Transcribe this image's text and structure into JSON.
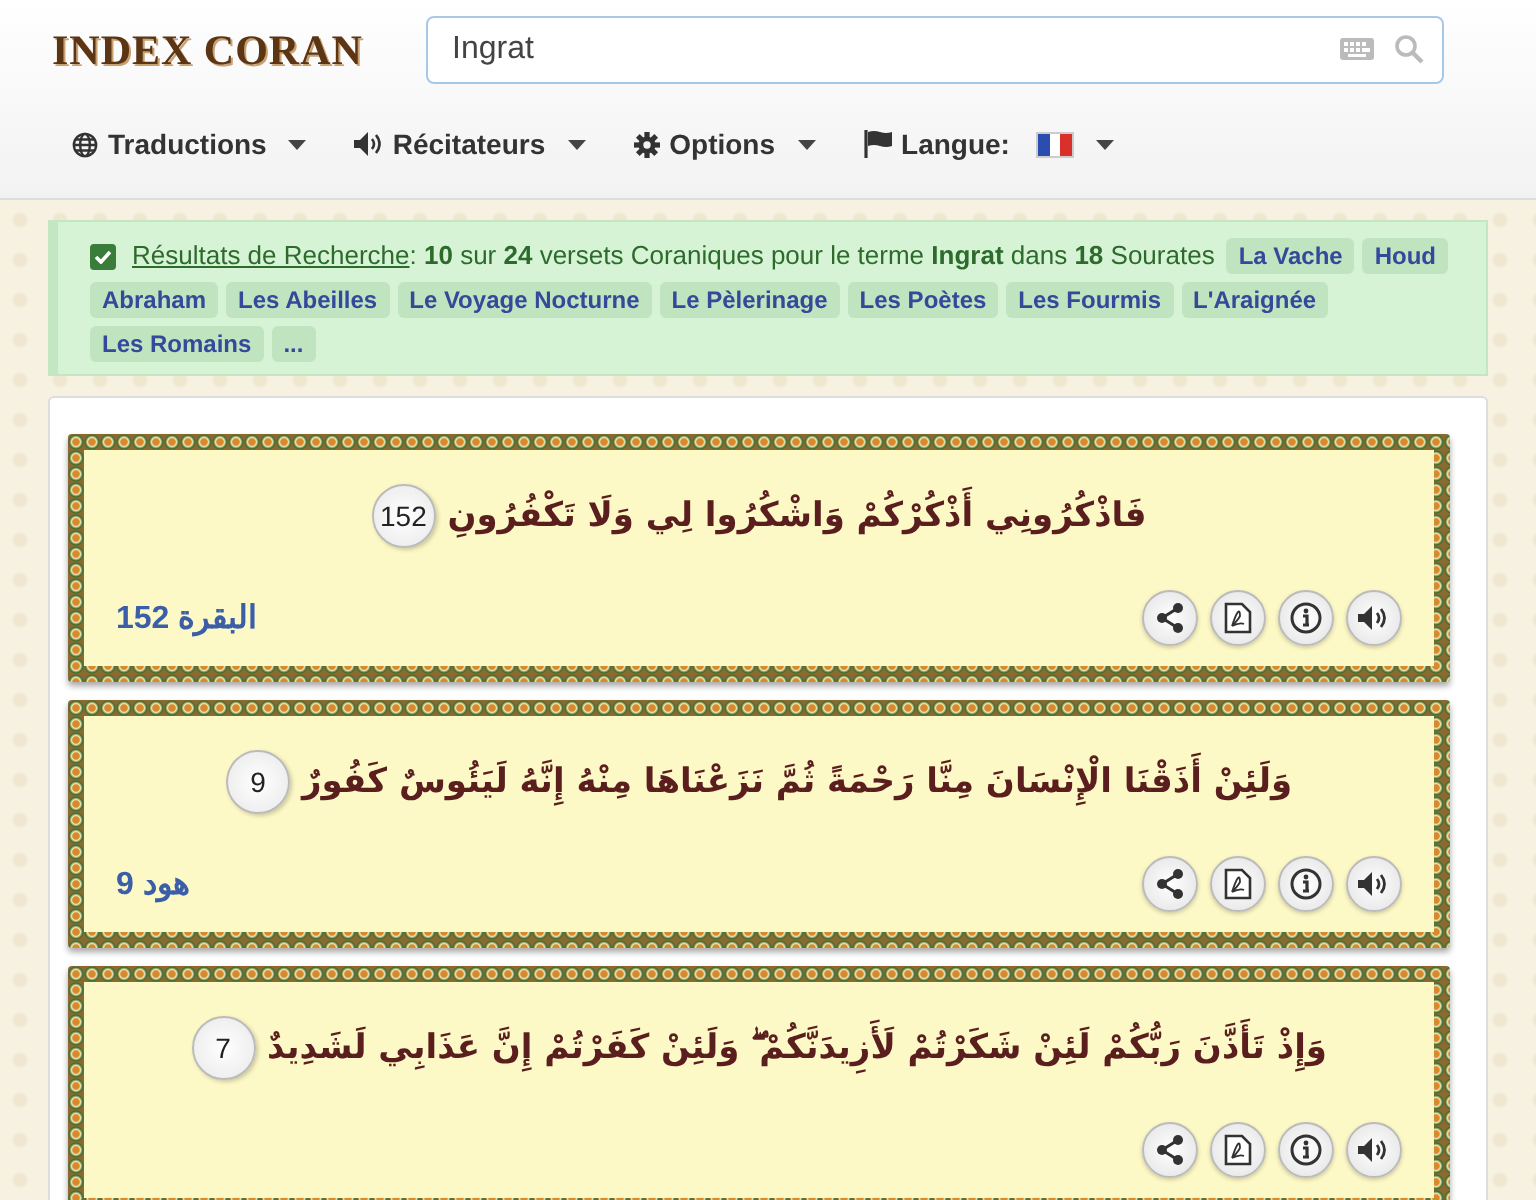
{
  "logo": "INDEX CORAN",
  "search": {
    "value": "Ingrat"
  },
  "nav": [
    {
      "kind": "globe",
      "label": "Traductions"
    },
    {
      "kind": "speaker",
      "label": "Récitateurs"
    },
    {
      "kind": "gear",
      "label": "Options"
    },
    {
      "kind": "flag",
      "label": "Langue:",
      "language_flag": true
    }
  ],
  "results": {
    "checked": true,
    "link": "Résultats de Recherche",
    "summary": ": **10** sur **24** versets Coraniques pour le terme **Ingrat** dans **18** Sourates",
    "tags": [
      "La Vache",
      "Houd",
      "Abraham",
      "Les Abeilles",
      "Le Voyage Nocturne",
      "Le Pèlerinage",
      "Les Poètes",
      "Les Fourmis",
      "L'Araignée",
      "Les Romains",
      "..."
    ]
  },
  "verses": [
    {
      "text": "فَاذْكُرُونِي أَذْكُرْكُمْ وَاشْكُرُوا لِي وَلَا تَكْفُرُونِ",
      "number": "152",
      "reference": "البقرة 152"
    },
    {
      "text": "وَلَئِنْ أَذَقْنَا الْإِنْسَانَ مِنَّا رَحْمَةً ثُمَّ نَزَعْنَاهَا مِنْهُ إِنَّهُ لَيَئُوسٌ كَفُورٌ",
      "number": "9",
      "reference": "هود 9"
    },
    {
      "text": "وَإِذْ تَأَذَّنَ رَبُّكُمْ لَئِنْ شَكَرْتُمْ لَأَزِيدَنَّكُمْ ۖ وَلَئِنْ كَفَرْتُمْ إِنَّ عَذَابِي لَشَدِيدٌ",
      "number": "7"
    }
  ]
}
